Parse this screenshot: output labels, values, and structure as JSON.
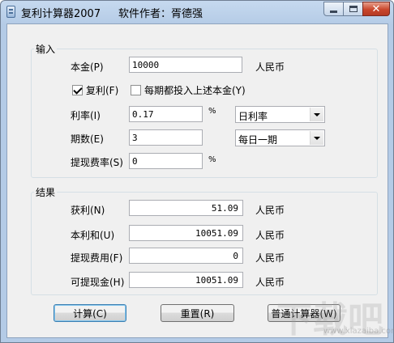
{
  "window": {
    "title": "复利计算器2007",
    "author": "软件作者：胥德强",
    "minimize_icon": "minimize-icon",
    "maximize_icon": "maximize-icon",
    "close_icon": "close-icon",
    "close_glyph": "✕"
  },
  "input_group": {
    "legend": "输入",
    "principal": {
      "label": "本金(P)",
      "value": "10000",
      "unit": "人民币"
    },
    "compound": {
      "label": "复利(F)",
      "checked": true
    },
    "reinvest": {
      "label": "每期都投入上述本金(Y)",
      "checked": false
    },
    "rate": {
      "label": "利率(I)",
      "value": "0.17",
      "unit": "%",
      "type_selected": "日利率"
    },
    "periods": {
      "label": "期数(E)",
      "value": "3",
      "freq_selected": "每日一期"
    },
    "fee_rate": {
      "label": "提现费率(S)",
      "value": "0",
      "unit": "%"
    }
  },
  "result_group": {
    "legend": "结果",
    "profit": {
      "label": "获利(N)",
      "value": "51.09",
      "unit": "人民币"
    },
    "total": {
      "label": "本利和(U)",
      "value": "10051.09",
      "unit": "人民币"
    },
    "fee": {
      "label": "提现费用(F)",
      "value": "0",
      "unit": "人民币"
    },
    "withdrawable": {
      "label": "可提现金(H)",
      "value": "10051.09",
      "unit": "人民币"
    }
  },
  "buttons": {
    "calculate": "计算(C)",
    "reset": "重置(R)",
    "normal_calc": "普通计算器(W)"
  },
  "watermark": {
    "text": "下载吧",
    "url": "www.xiazaiba.com"
  },
  "colors": {
    "titlebar": "#b4cbe6",
    "close_button": "#c9462c",
    "client_bg": "#f0f0f0"
  }
}
